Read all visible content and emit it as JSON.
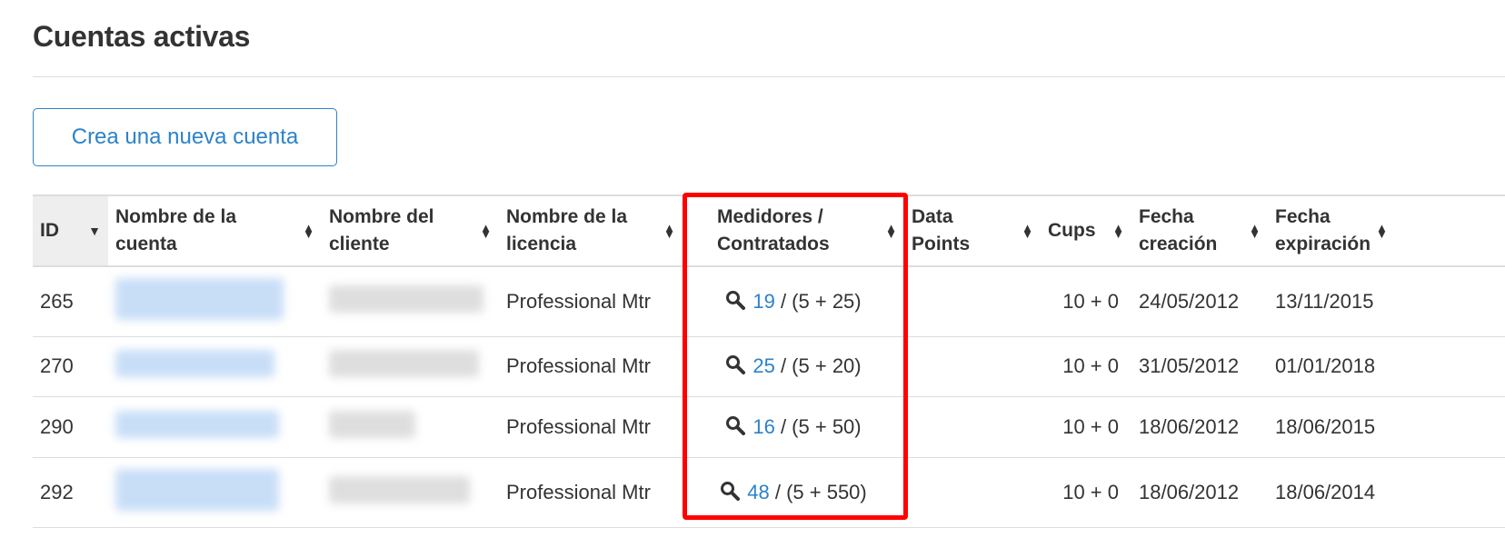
{
  "page": {
    "title": "Cuentas activas",
    "create_button_label": "Crea una nueva cuenta"
  },
  "table": {
    "headers": {
      "id": "ID",
      "account_name": "Nombre de la\ncuenta",
      "client_name": "Nombre del\ncliente",
      "license_name": "Nombre de la\nlicencia",
      "meters": "Medidores /\nContratados",
      "data_points": "Data\nPoints",
      "cups": "Cups",
      "created": "Fecha\ncreación",
      "expires": "Fecha\nexpiración"
    },
    "rows": [
      {
        "id": "265",
        "license": "Professional Mtr",
        "meters_used": "19",
        "meters_contracted": " / (5 + 25)",
        "data_points": "",
        "cups": "10 + 0",
        "created": "24/05/2012",
        "expires": "13/11/2015"
      },
      {
        "id": "270",
        "license": "Professional Mtr",
        "meters_used": "25",
        "meters_contracted": " / (5 + 20)",
        "data_points": "",
        "cups": "10 + 0",
        "created": "31/05/2012",
        "expires": "01/01/2018"
      },
      {
        "id": "290",
        "license": "Professional Mtr",
        "meters_used": "16",
        "meters_contracted": " / (5 + 50)",
        "data_points": "",
        "cups": "10 + 0",
        "created": "18/06/2012",
        "expires": "18/06/2015"
      },
      {
        "id": "292",
        "license": "Professional Mtr",
        "meters_used": "48",
        "meters_contracted": " / (5 + 550)",
        "data_points": "",
        "cups": "10 + 0",
        "created": "18/06/2012",
        "expires": "18/06/2014"
      }
    ]
  },
  "colors": {
    "link": "#2c82c9",
    "highlight": "#ff0000",
    "sorted_header_bg": "#eeeeee"
  },
  "icons": {
    "sort": "sort-both-icon",
    "sorted_desc": "caret-down-icon",
    "meter_search": "search-icon"
  }
}
